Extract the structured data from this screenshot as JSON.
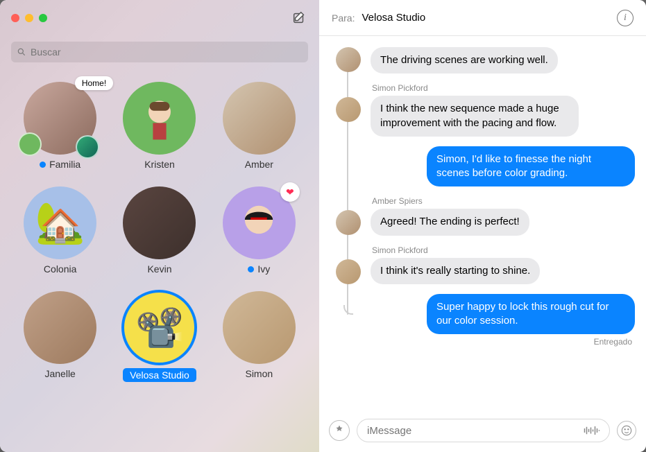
{
  "search": {
    "placeholder": "Buscar"
  },
  "compose_label": "Redactar",
  "contacts": [
    {
      "name": "Familia",
      "unread": true,
      "badge_text": "Home!"
    },
    {
      "name": "Kristen",
      "unread": false
    },
    {
      "name": "Amber",
      "unread": false
    },
    {
      "name": "Colonia",
      "unread": false
    },
    {
      "name": "Kevin",
      "unread": false
    },
    {
      "name": "Ivy",
      "unread": true,
      "heart": true
    },
    {
      "name": "Janelle",
      "unread": false
    },
    {
      "name": "Velosa Studio",
      "unread": false,
      "selected": true
    },
    {
      "name": "Simon",
      "unread": false
    }
  ],
  "header": {
    "para_label": "Para:",
    "to_name": "Velosa Studio"
  },
  "messages": [
    {
      "sender": "",
      "dir": "in",
      "text": "The driving scenes are working well."
    },
    {
      "sender": "Simon Pickford",
      "dir": "in",
      "text": "I think the new sequence made a huge improvement with the pacing and flow."
    },
    {
      "sender": "",
      "dir": "out",
      "text": "Simon, I'd like to finesse the night scenes before color grading."
    },
    {
      "sender": "Amber Spiers",
      "dir": "in",
      "text": "Agreed! The ending is perfect!"
    },
    {
      "sender": "Simon Pickford",
      "dir": "in",
      "text": "I think it's really starting to shine."
    },
    {
      "sender": "",
      "dir": "out",
      "text": "Super happy to lock this rough cut for our color session."
    }
  ],
  "delivered_label": "Entregado",
  "composer": {
    "placeholder": "iMessage"
  }
}
